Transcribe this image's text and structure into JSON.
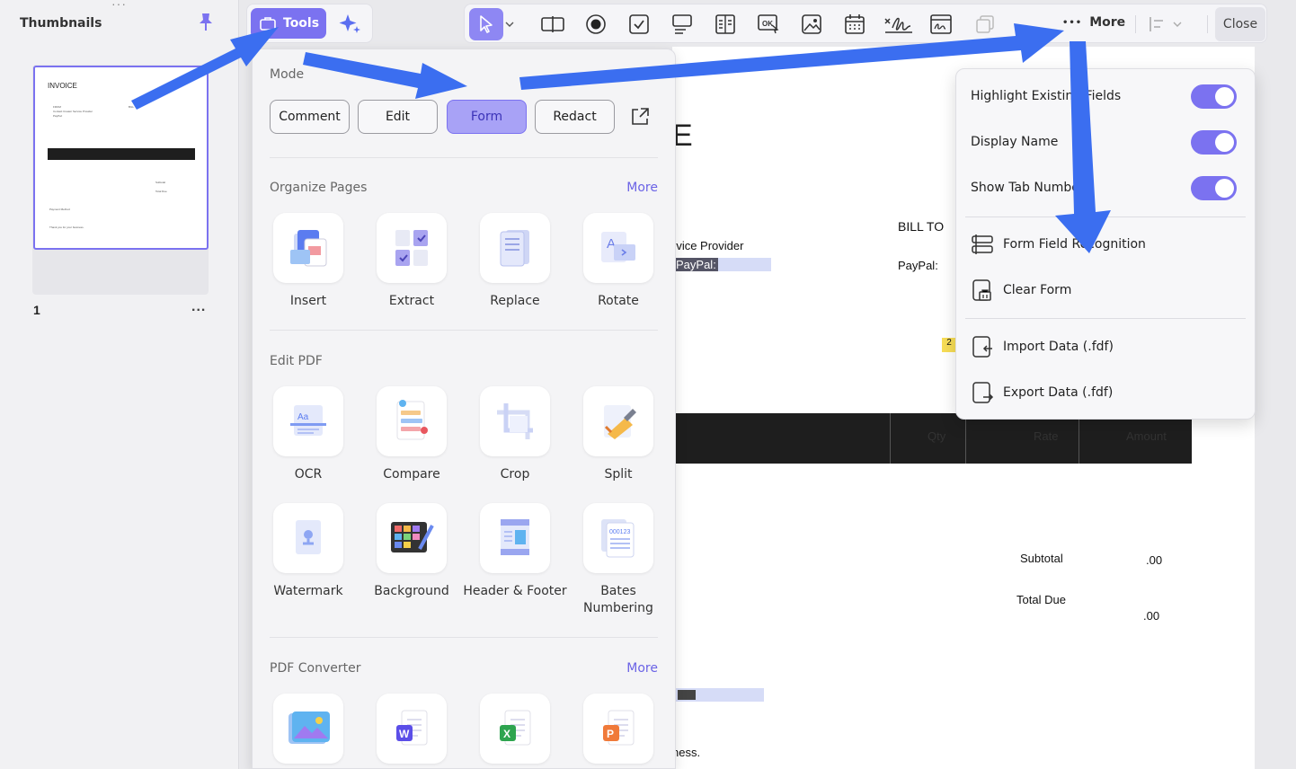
{
  "thumbnails": {
    "title": "Thumbnails",
    "page_number": "1",
    "page_menu": "...",
    "mini_invoice": {
      "heading": "INVOICE",
      "from": "FROM",
      "provider": "Contact Creator Service Provider",
      "paypal": "PayPal:",
      "bill_to": "BILL TO",
      "subtotal": "Subtotal",
      "total_due": "Total Due",
      "payment": "Payment Method",
      "thanks": "Thank you for your business."
    }
  },
  "toolbar": {
    "tools_label": "Tools",
    "more_label": "More",
    "more_dots": "•••",
    "close_label": "Close",
    "icons": [
      "select-icon",
      "text-field-icon",
      "radio-button-icon",
      "checkbox-icon",
      "combo-box-icon",
      "list-box-icon",
      "ok-button-icon",
      "image-field-icon",
      "date-field-icon",
      "signature-icon",
      "digital-signature-icon",
      "copy-icon",
      "align-icon"
    ]
  },
  "tools_panel": {
    "mode_title": "Mode",
    "modes": [
      "Comment",
      "Edit",
      "Form",
      "Redact"
    ],
    "active_mode": "Form",
    "organize": {
      "title": "Organize Pages",
      "more": "More",
      "items": [
        "Insert",
        "Extract",
        "Replace",
        "Rotate"
      ]
    },
    "edit_pdf": {
      "title": "Edit PDF",
      "items": [
        "OCR",
        "Compare",
        "Crop",
        "Split",
        "Watermark",
        "Background",
        "Header & Footer",
        "Bates Numbering"
      ]
    },
    "converter": {
      "title": "PDF Converter",
      "more": "More",
      "items": [
        "image-icon",
        "word-icon",
        "excel-icon",
        "powerpoint-icon"
      ]
    }
  },
  "more_menu": {
    "toggles": [
      {
        "label": "Highlight Existing Fields",
        "on": true
      },
      {
        "label": "Display Name",
        "on": true
      },
      {
        "label": "Show Tab Number",
        "on": true
      }
    ],
    "actions": [
      "Form Field Recognition",
      "Clear Form"
    ],
    "data_actions": [
      "Import Data (.fdf)",
      "Export Data (.fdf)"
    ]
  },
  "document": {
    "heading_fragment": "E",
    "provider_fragment": "rvice Provider",
    "paypal_field": "PayPal:",
    "bill_to": "BILL TO",
    "paypal": "PayPal:",
    "badge": "2",
    "table_headers": [
      "Qty",
      "Rate",
      "Amount"
    ],
    "subtotal_label": "Subtotal",
    "subtotal_value": ".00",
    "total_label": "Total Due",
    "total_value": ".00",
    "footer_fragment": "ness."
  },
  "colors": {
    "accent": "#7b72f0",
    "arrow": "#3b6ef0",
    "table_header": "#1e1e1e"
  }
}
